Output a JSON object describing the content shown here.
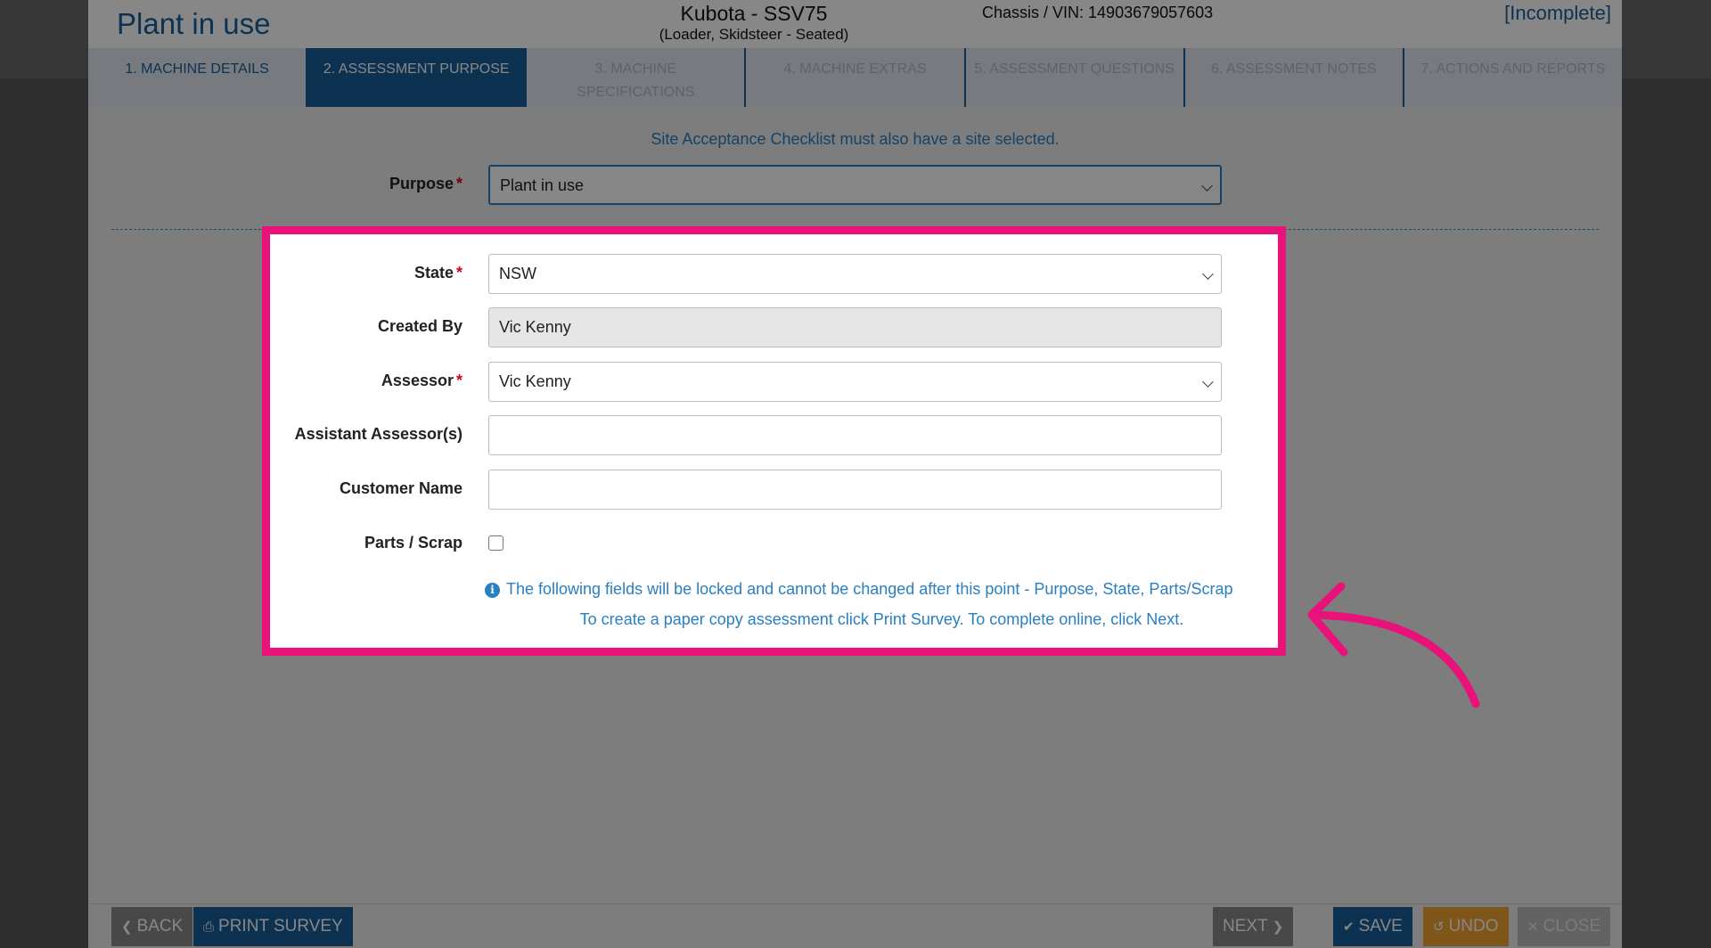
{
  "header": {
    "title": "Plant in use",
    "machine_name": "Kubota - SSV75",
    "machine_type": "(Loader, Skidsteer - Seated)",
    "vin": "Chassis / VIN: 14903679057603",
    "status": "[Incomplete]"
  },
  "tabs": [
    {
      "label": "1. Machine Details",
      "state": "done"
    },
    {
      "label": "2. Assessment Purpose",
      "state": "active"
    },
    {
      "label": "3. Machine Specifications",
      "state": "disabled"
    },
    {
      "label": "4. Machine Extras",
      "state": "disabled"
    },
    {
      "label": "5. Assessment Questions",
      "state": "disabled"
    },
    {
      "label": "6. Assessment Notes",
      "state": "disabled"
    },
    {
      "label": "7. Actions and Reports",
      "state": "disabled"
    }
  ],
  "notice": "Site Acceptance Checklist must also have a site selected.",
  "purpose": {
    "label": "Purpose",
    "required_mark": "*",
    "value": "Plant in use"
  },
  "form": {
    "state": {
      "label": "State",
      "required_mark": "*",
      "value": "NSW"
    },
    "created_by": {
      "label": "Created By",
      "value": "Vic Kenny"
    },
    "assessor": {
      "label": "Assessor",
      "required_mark": "*",
      "value": "Vic Kenny"
    },
    "assistant_assessors": {
      "label": "Assistant Assessor(s)",
      "value": ""
    },
    "customer_name": {
      "label": "Customer Name",
      "value": ""
    },
    "parts_scrap": {
      "label": "Parts / Scrap",
      "checked": false
    }
  },
  "info_message": "The following fields will be locked and cannot be changed after this point - Purpose, State, Parts/Scrap",
  "help_message": "To create a paper copy assessment click Print Survey. To complete online, click Next.",
  "footer": {
    "back": "Back",
    "print_survey": "Print Survey",
    "next": "Next",
    "save": "Save",
    "undo": "Undo",
    "close": "Close"
  },
  "icons": {
    "info": "info-circle-icon",
    "back": "chevron-left-icon",
    "print": "printer-icon",
    "next": "chevron-right-icon",
    "save": "check-icon",
    "undo": "undo-icon",
    "close": "x-icon"
  },
  "colors": {
    "primary": "#1a5f9a",
    "link": "#2a7fbf",
    "required": "#d0021b",
    "undo": "#f0a030",
    "highlight": "#e8127a"
  }
}
